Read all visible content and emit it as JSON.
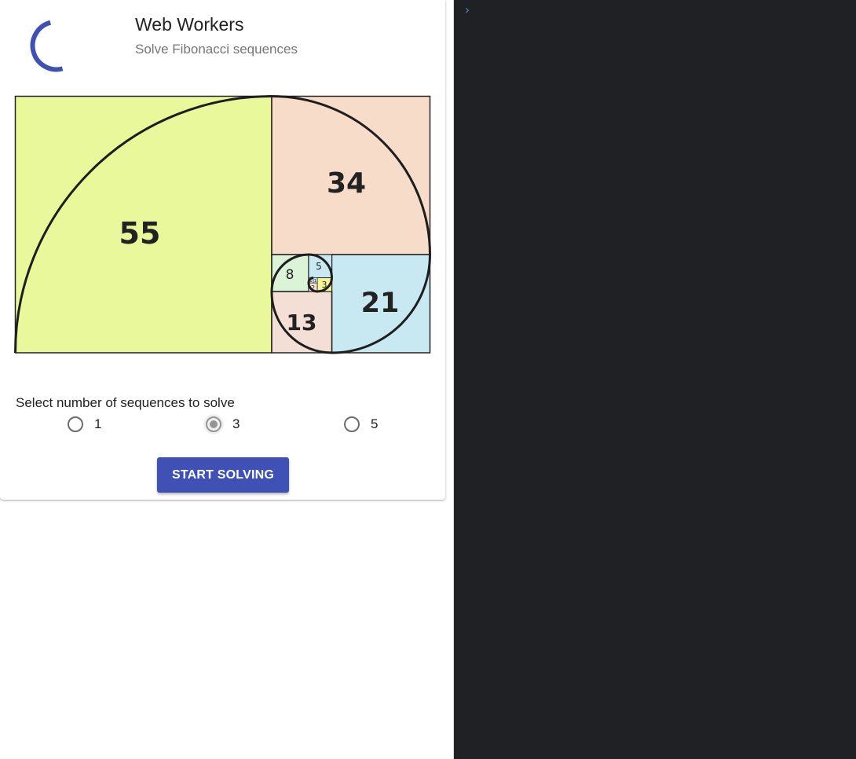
{
  "header": {
    "title": "Web Workers",
    "subtitle": "Solve Fibonacci sequences"
  },
  "fibonacci_image": {
    "labels": [
      "55",
      "34",
      "21",
      "13",
      "8",
      "5",
      "3",
      "2",
      "1",
      "1"
    ]
  },
  "form": {
    "select_label": "Select number of sequences to solve",
    "options": [
      {
        "label": "1",
        "checked": false
      },
      {
        "label": "3",
        "checked": true
      },
      {
        "label": "5",
        "checked": false
      }
    ],
    "start_button_label": "START SOLVING"
  },
  "console": {
    "prompt_icon": "chevron-right-icon",
    "prompt_glyph": "›"
  },
  "colors": {
    "accent": "#3f51b5",
    "console_bg": "#202124",
    "sq55": "#eaf89c",
    "sq34": "#f7dcca",
    "sq21": "#c8e8f2",
    "sq13": "#f3dfd6",
    "sq8": "#dbf3d7",
    "sq5": "#c8e8f2",
    "sq3": "#f5f596"
  }
}
